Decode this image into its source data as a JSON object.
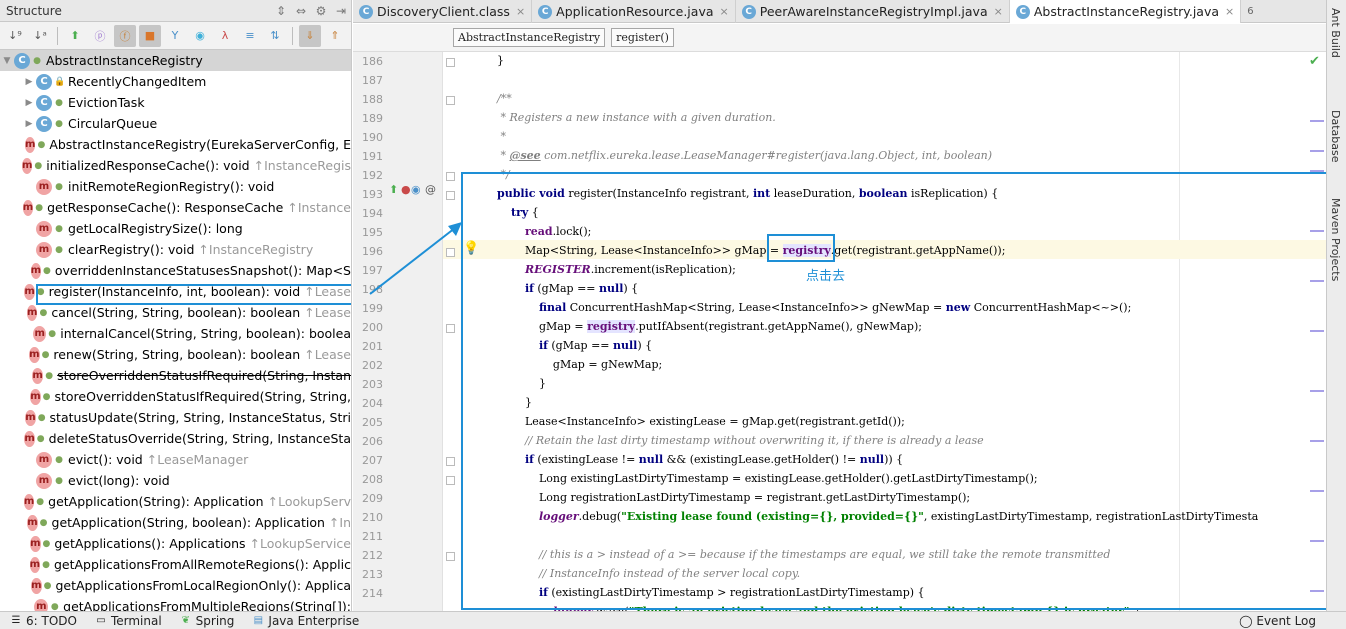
{
  "structure": {
    "title": "Structure",
    "root": "AbstractInstanceRegistry",
    "items": [
      {
        "kind": "class",
        "vis": "lock",
        "sig": "RecentlyChangedItem",
        "hint": "",
        "expand": true,
        "struck": false
      },
      {
        "kind": "class",
        "vis": "",
        "sig": "EvictionTask",
        "hint": "",
        "expand": true,
        "struck": false
      },
      {
        "kind": "class",
        "vis": "",
        "sig": "CircularQueue",
        "hint": "",
        "expand": true,
        "struck": false
      },
      {
        "kind": "method",
        "vis": "",
        "sig": "AbstractInstanceRegistry(EurekaServerConfig, E",
        "hint": "",
        "struck": false
      },
      {
        "kind": "method",
        "vis": "",
        "sig": "initializedResponseCache(): void",
        "hint": "↑InstanceRegis",
        "struck": false
      },
      {
        "kind": "method",
        "vis": "",
        "sig": "initRemoteRegionRegistry(): void",
        "hint": "",
        "struck": false
      },
      {
        "kind": "method",
        "vis": "",
        "sig": "getResponseCache(): ResponseCache",
        "hint": "↑Instance",
        "struck": false
      },
      {
        "kind": "method",
        "vis": "",
        "sig": "getLocalRegistrySize(): long",
        "hint": "",
        "struck": false
      },
      {
        "kind": "method",
        "vis": "",
        "sig": "clearRegistry(): void",
        "hint": "↑InstanceRegistry",
        "struck": false
      },
      {
        "kind": "method",
        "vis": "",
        "sig": "overriddenInstanceStatusesSnapshot(): Map<S",
        "hint": "",
        "struck": false
      },
      {
        "kind": "method",
        "vis": "",
        "sig": "register(InstanceInfo, int, boolean): void",
        "hint": "↑Lease",
        "struck": false
      },
      {
        "kind": "method",
        "vis": "",
        "sig": "cancel(String, String, boolean): boolean",
        "hint": "↑Lease",
        "struck": false
      },
      {
        "kind": "method",
        "vis": "",
        "sig": "internalCancel(String, String, boolean): boolea",
        "hint": "",
        "struck": false
      },
      {
        "kind": "method",
        "vis": "",
        "sig": "renew(String, String, boolean): boolean",
        "hint": "↑Lease",
        "struck": false
      },
      {
        "kind": "method",
        "vis": "",
        "sig": "storeOverriddenStatusIfRequired(String, Instan",
        "hint": "",
        "struck": true
      },
      {
        "kind": "method",
        "vis": "",
        "sig": "storeOverriddenStatusIfRequired(String, String,",
        "hint": "",
        "struck": false
      },
      {
        "kind": "method",
        "vis": "",
        "sig": "statusUpdate(String, String, InstanceStatus, Stri",
        "hint": "",
        "struck": false
      },
      {
        "kind": "method",
        "vis": "",
        "sig": "deleteStatusOverride(String, String, InstanceSta",
        "hint": "",
        "struck": false
      },
      {
        "kind": "method",
        "vis": "",
        "sig": "evict(): void",
        "hint": "↑LeaseManager",
        "struck": false
      },
      {
        "kind": "method",
        "vis": "",
        "sig": "evict(long): void",
        "hint": "",
        "struck": false
      },
      {
        "kind": "method",
        "vis": "",
        "sig": "getApplication(String): Application",
        "hint": "↑LookupServ",
        "struck": false
      },
      {
        "kind": "method",
        "vis": "",
        "sig": "getApplication(String, boolean): Application",
        "hint": "↑In",
        "struck": false
      },
      {
        "kind": "method",
        "vis": "",
        "sig": "getApplications(): Applications",
        "hint": "↑LookupService",
        "struck": false
      },
      {
        "kind": "method",
        "vis": "",
        "sig": "getApplicationsFromAllRemoteRegions(): Applic",
        "hint": "",
        "struck": false
      },
      {
        "kind": "method",
        "vis": "",
        "sig": "getApplicationsFromLocalRegionOnly(): Applica",
        "hint": "",
        "struck": false
      },
      {
        "kind": "method",
        "vis": "",
        "sig": "getApplicationsFromMultipleRegions(String[]):",
        "hint": "",
        "struck": false
      }
    ]
  },
  "tabs": [
    "DiscoveryClient.class",
    "ApplicationResource.java",
    "PeerAwareInstanceRegistryImpl.java",
    "AbstractInstanceRegistry.java"
  ],
  "tab_overflow": "6",
  "breadcrumb": [
    "AbstractInstanceRegistry",
    "register()"
  ],
  "editor": {
    "line_numbers": [
      "186",
      "187",
      "188",
      "189",
      "190",
      "191",
      "192",
      "193",
      "194",
      "195",
      "196",
      "197",
      "198",
      "199",
      "200",
      "201",
      "202",
      "203",
      "204",
      "205",
      "206",
      "207",
      "208",
      "209",
      "210",
      "211",
      "212",
      "213",
      "214"
    ],
    "annotation": "点击去"
  },
  "right_tabs": [
    "Ant Build",
    "Database",
    "Maven Projects"
  ],
  "status": {
    "items": [
      "6: TODO",
      "Terminal",
      "Spring",
      "Java Enterprise"
    ],
    "event_log": "Event Log"
  }
}
